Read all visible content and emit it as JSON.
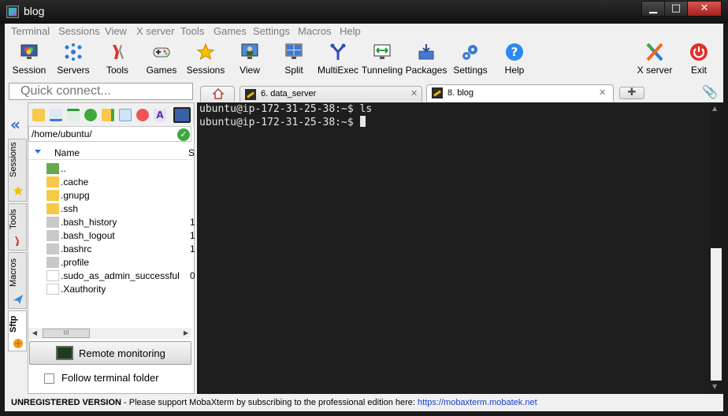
{
  "window": {
    "title": "blog",
    "minimize": "▁",
    "maximize": "□",
    "close": "✕"
  },
  "menu": [
    "Terminal",
    "Sessions",
    "View",
    "X server",
    "Tools",
    "Games",
    "Settings",
    "Macros",
    "Help"
  ],
  "toolbar": {
    "session": "Session",
    "servers": "Servers",
    "tools": "Tools",
    "games": "Games",
    "sessions": "Sessions",
    "view": "View",
    "split": "Split",
    "multiexec": "MultiExec",
    "tunneling": "Tunneling",
    "packages": "Packages",
    "settings": "Settings",
    "help": "Help",
    "xserver": "X server",
    "exit": "Exit"
  },
  "quick_connect": {
    "placeholder": "Quick connect..."
  },
  "side_tabs": {
    "sessions": "Sessions",
    "tools": "Tools",
    "macros": "Macros",
    "sftp": "Sftp"
  },
  "sftp": {
    "path": "/home/ubuntu/",
    "columns": {
      "name": "Name",
      "size": "S"
    },
    "files": [
      {
        "name": "..",
        "type": "up",
        "size": ""
      },
      {
        "name": ".cache",
        "type": "folder",
        "size": ""
      },
      {
        "name": ".gnupg",
        "type": "folder",
        "size": ""
      },
      {
        "name": ".ssh",
        "type": "folder",
        "size": ""
      },
      {
        "name": ".bash_history",
        "type": "file",
        "size": "1"
      },
      {
        "name": ".bash_logout",
        "type": "file",
        "size": "1"
      },
      {
        "name": ".bashrc",
        "type": "file",
        "size": "1"
      },
      {
        "name": ".profile",
        "type": "file",
        "size": ""
      },
      {
        "name": ".sudo_as_admin_successful",
        "type": "empty",
        "size": "0"
      },
      {
        "name": ".Xauthority",
        "type": "empty",
        "size": ""
      }
    ],
    "hscroll_thumb": "III",
    "remote_monitoring": "Remote monitoring",
    "follow_terminal_folder": "Follow terminal folder"
  },
  "tabs": [
    {
      "label": "6. data_server",
      "close": "✕"
    },
    {
      "label": "8. blog",
      "close": "✕"
    }
  ],
  "terminal": {
    "lines": [
      "ubuntu@ip-172-31-25-38:~$ ls",
      "ubuntu@ip-172-31-25-38:~$ "
    ]
  },
  "status": {
    "bold": "UNREGISTERED VERSION",
    "text": "  -  Please support MobaXterm by subscribing to the professional edition here:  ",
    "link": "https://mobaxterm.mobatek.net"
  },
  "colors": {
    "accent": "#2a6ed6",
    "terminal_bg": "#1e1e1e",
    "terminal_fg": "#e6e6e6",
    "link": "#1a3fcc"
  }
}
